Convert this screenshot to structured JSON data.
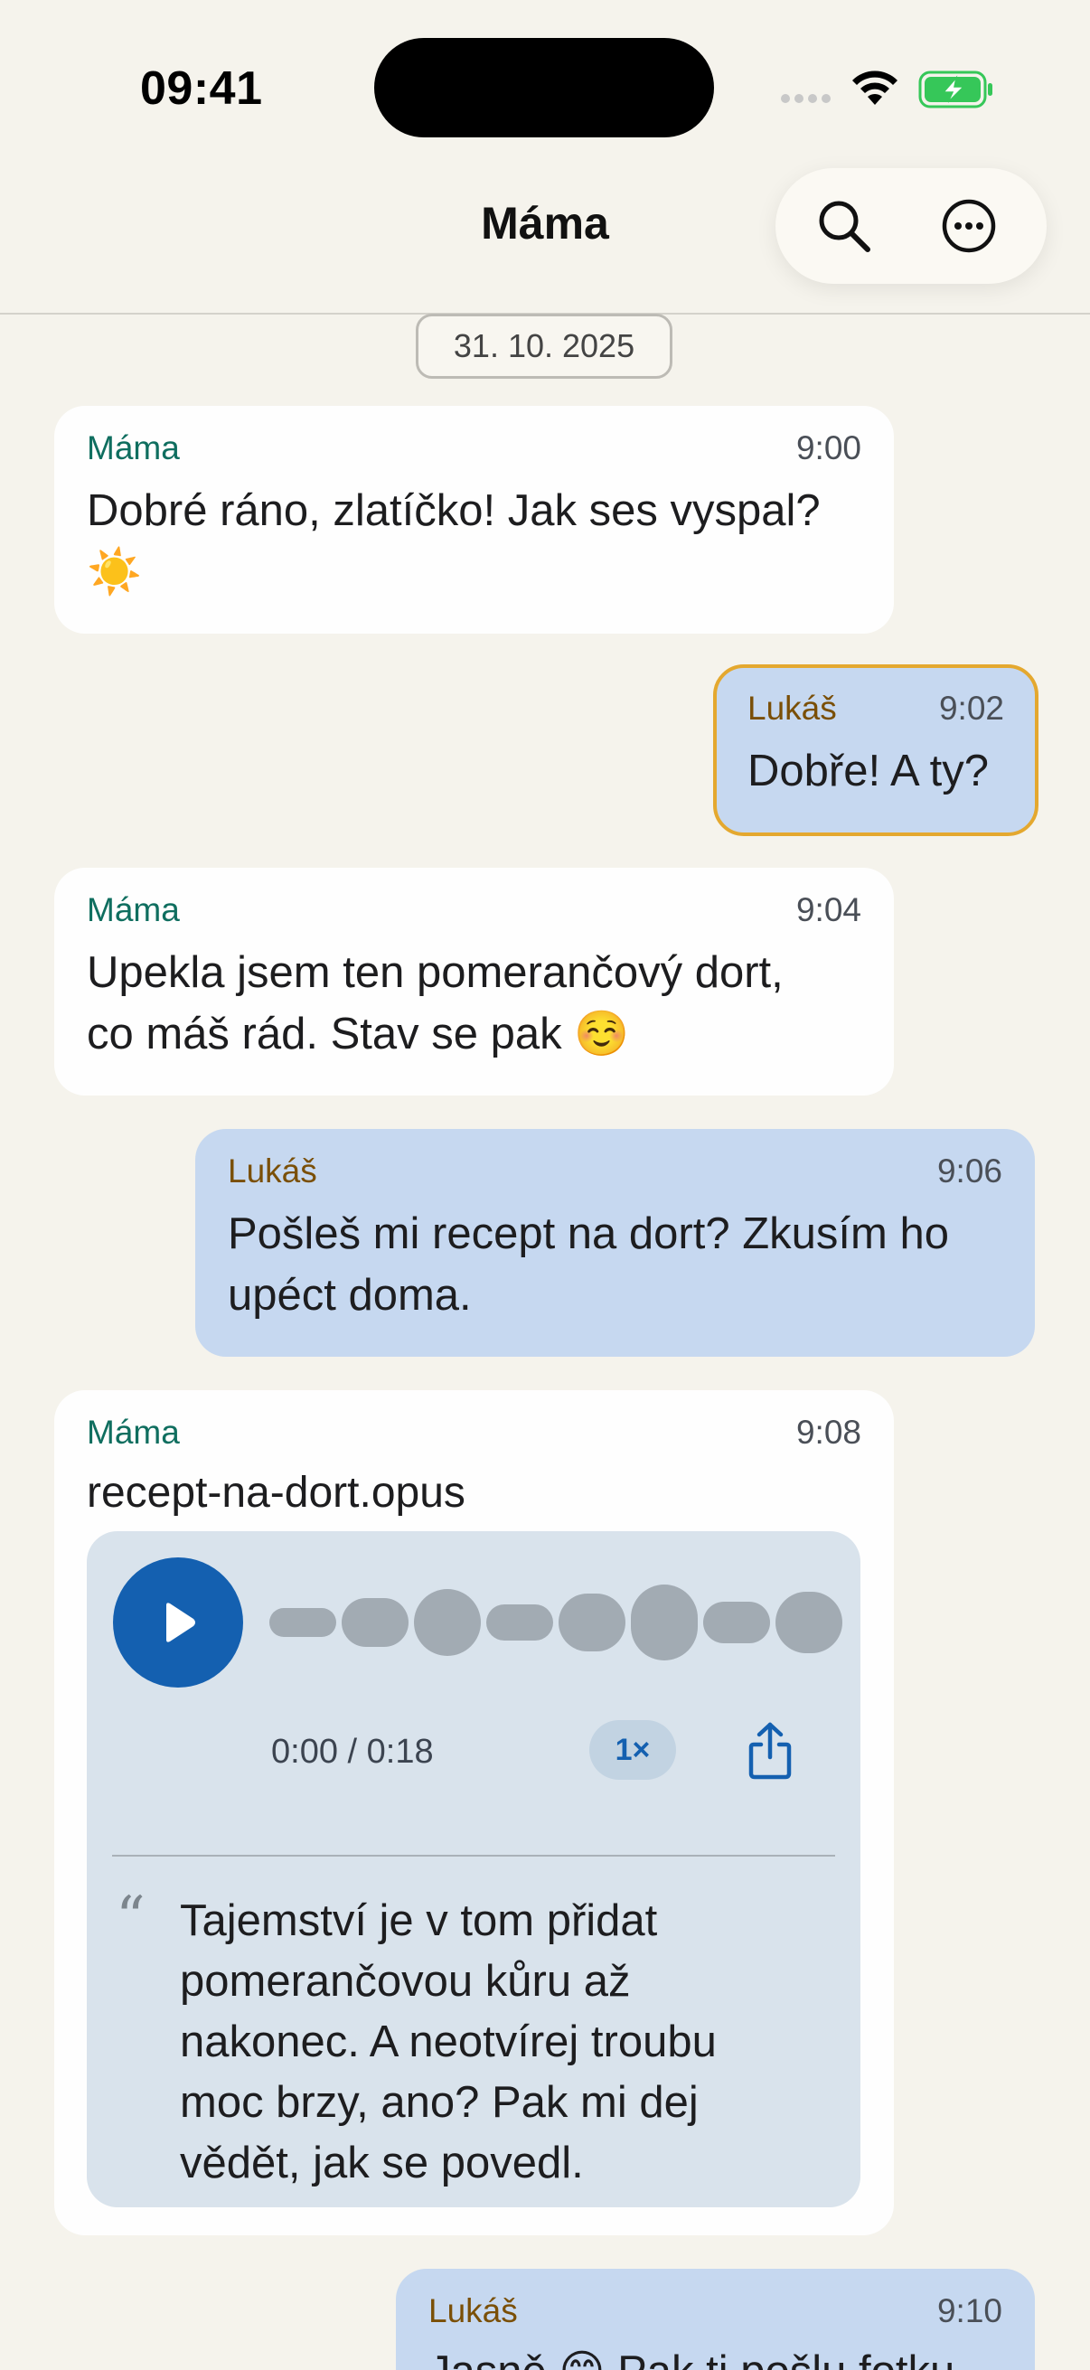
{
  "status_bar": {
    "time": "09:41",
    "icons": [
      "signal-dots-icon",
      "wifi-icon",
      "battery-charging-icon"
    ],
    "battery_color": "#36c759"
  },
  "header": {
    "title": "Máma",
    "actions": [
      "search-icon",
      "more-icon"
    ]
  },
  "date_separator": "31. 10. 2025",
  "colors": {
    "background": "#f5f3ec",
    "incoming_bubble": "#fefefe",
    "outgoing_bubble": "#c6d8f0",
    "incoming_sender": "#0f6e5f",
    "outgoing_sender": "#7a4f07",
    "highlight_border": "#e4a82f",
    "accent": "#1460b0"
  },
  "messages": [
    {
      "direction": "in",
      "sender": "Máma",
      "time": "9:00",
      "text_lines": [
        "Dobré ráno, zlatíčko! Jak ses vyspal?",
        "☀️"
      ]
    },
    {
      "direction": "out",
      "sender": "Lukáš",
      "time": "9:02",
      "text_lines": [
        "Dobře! A ty?"
      ],
      "highlighted": true
    },
    {
      "direction": "in",
      "sender": "Máma",
      "time": "9:04",
      "text_lines": [
        "Upekla jsem ten pomerančový dort,",
        "co máš rád. Stav se pak ☺️"
      ]
    },
    {
      "direction": "out",
      "sender": "Lukáš",
      "time": "9:06",
      "text_lines": [
        "Pošleš mi recept na dort? Zkusím ho",
        "upéct doma."
      ]
    },
    {
      "direction": "in",
      "sender": "Máma",
      "time": "9:08",
      "attachment": {
        "file_name": "recept-na-dort.opus",
        "duration": "0:00 / 0:18",
        "playback_progress": 0,
        "speed": "1×",
        "icons": [
          "play-icon",
          "share-icon",
          "quote-icon"
        ],
        "transcript_lines": [
          "Tajemství je v tom přidat",
          "pomerančovou kůru až",
          "nakonec. A neotvírej troubu",
          "moc brzy, ano? Pak mi dej",
          "vědět, jak se povedl."
        ]
      }
    },
    {
      "direction": "out",
      "sender": "Lukáš",
      "time": "9:10",
      "text_lines": [
        "Jasně 😊 Pak ti pošlu fotku"
      ]
    }
  ]
}
